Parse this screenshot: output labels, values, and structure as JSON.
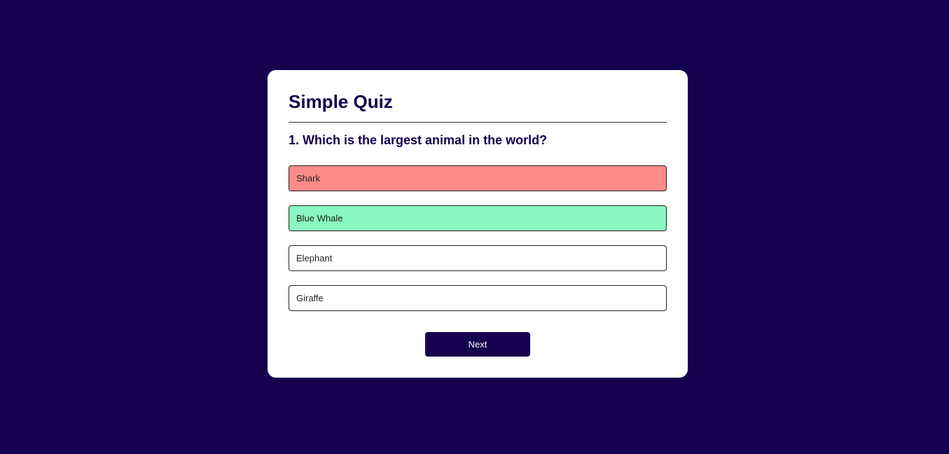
{
  "quiz": {
    "title": "Simple Quiz",
    "question": "1. Which is the largest animal in the world?",
    "answers": [
      {
        "label": "Shark",
        "state": "incorrect"
      },
      {
        "label": "Blue Whale",
        "state": "correct"
      },
      {
        "label": "Elephant",
        "state": "unanswered"
      },
      {
        "label": "Giraffe",
        "state": "unanswered"
      }
    ],
    "next_label": "Next"
  },
  "colors": {
    "background": "#15004d",
    "card": "#ffffff",
    "incorrect": "#ff8a8a",
    "correct": "#8af7c2"
  }
}
